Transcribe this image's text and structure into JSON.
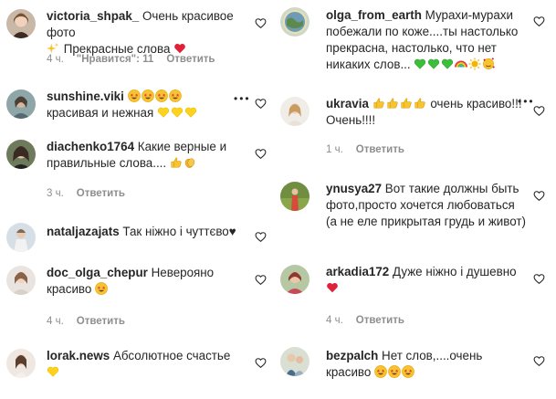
{
  "left_comments": [
    {
      "user": "victoria_shpak_",
      "text": "Очень красивое фото",
      "emoji_after_text": [
        "sparkles-emoji"
      ],
      "text2": " Прекрасные слова",
      "emoji_end": [
        "red-heart-emoji"
      ],
      "time": "4 ч.",
      "likes": "\"Нравится\": 11",
      "reply": "Ответить"
    },
    {
      "user": "sunshine.viki",
      "text": "",
      "emoji_inline": [
        "star-struck-emoji",
        "star-struck-emoji",
        "star-struck-emoji",
        "star-struck-emoji"
      ],
      "text2": "красивая и нежная",
      "emoji_end": [
        "yellow-heart-emoji",
        "yellow-heart-emoji",
        "yellow-heart-emoji"
      ],
      "time": "",
      "likes": "",
      "reply": ""
    },
    {
      "user": "diachenko1764",
      "text": "Какие верные и правильные слова....",
      "emoji_end": [
        "thumbs-up-emoji",
        "clapping-hands-emoji"
      ],
      "time": "3 ч.",
      "likes": "",
      "reply": "Ответить"
    },
    {
      "user": "nataljazajats",
      "text": "Так ніжно і чуттєво♥",
      "time": "",
      "likes": "",
      "reply": ""
    },
    {
      "user": "doc_olga_chepur",
      "text": "Неверояно красиво",
      "emoji_end": [
        "star-struck-emoji"
      ],
      "time": "4 ч.",
      "likes": "",
      "reply": "Ответить"
    },
    {
      "user": "lorak.news",
      "text": "Абсолютное счастье",
      "emoji_end": [
        "yellow-heart-emoji"
      ],
      "time": "",
      "likes": "",
      "reply": ""
    }
  ],
  "right_comments": [
    {
      "user": "olga_from_earth",
      "text": "Мурахи-мурахи побежали по коже....ты настолько прекрасна, настолько, что нет никаких слов...",
      "emoji_end": [
        "green-heart-emoji",
        "green-heart-emoji",
        "green-heart-emoji",
        "rainbow-emoji",
        "sun-emoji",
        "smiling-face-with-hearts-emoji"
      ],
      "time": "",
      "likes": "",
      "reply": ""
    },
    {
      "user": "ukravia",
      "text": "очень красиво!!! Очень!!!!",
      "emoji_inline": [
        "thumbs-up-emoji",
        "thumbs-up-emoji",
        "thumbs-up-emoji",
        "thumbs-up-emoji"
      ],
      "time": "1 ч.",
      "likes": "",
      "reply": "Ответить"
    },
    {
      "user": "ynusya27",
      "text": "Вот такие должны быть фото,просто хочется любоваться (а не еле прикрытая грудь и живот)",
      "time": "",
      "likes": "",
      "reply": ""
    },
    {
      "user": "arkadia172",
      "text": "Дуже ніжно і душевно",
      "emoji_end": [
        "red-heart-emoji"
      ],
      "time": "4 ч.",
      "likes": "",
      "reply": "Ответить"
    },
    {
      "user": "bezpalch",
      "text": "Нет слов,....очень красиво",
      "emoji_end": [
        "star-struck-emoji",
        "star-struck-emoji",
        "star-struck-emoji"
      ],
      "time": "",
      "likes": "",
      "reply": ""
    }
  ],
  "more_options_label": "•••",
  "colors": {
    "text": "#262626",
    "meta": "#8e8e8e",
    "heart_outline": "#262626"
  }
}
